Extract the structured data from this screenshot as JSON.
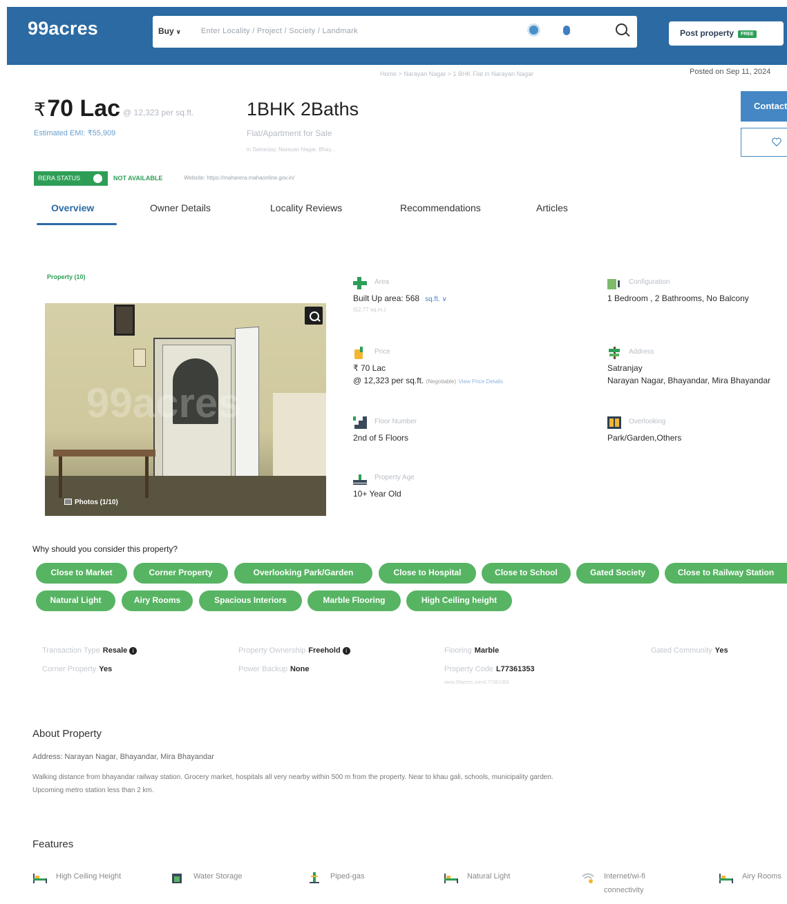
{
  "header": {
    "logo": "99acres",
    "buy_label": "Buy",
    "search_placeholder": "Enter Locality / Project / Society / Landmark",
    "post_property_label": "Post property",
    "free_badge": "FREE"
  },
  "breadcrumb": "Home > Narayan Nagar > 1 BHK Flat in Narayan Nagar",
  "posted": "Posted on Sep 11, 2024",
  "listing": {
    "price": "70 Lac",
    "rupee": "₹",
    "per_sqft": "@ 12,323 per sq.ft.",
    "emi": "Estimated EMI: ₹55,909",
    "config": "1BHK 2Baths",
    "sale_type": "Flat/Apartment for Sale",
    "sale_location": "in Satranjay, Narayan Nagar, Bhay..."
  },
  "actions": {
    "contact": "Contact Owner"
  },
  "rera": {
    "status_label": "RERA STATUS",
    "not_available": "NOT AVAILABLE",
    "website": "Website: https://maharera.mahaonline.gov.in/"
  },
  "tabs": [
    "Overview",
    "Owner Details",
    "Locality Reviews",
    "Recommendations",
    "Articles"
  ],
  "gallery": {
    "property_count": "Property (10)",
    "photos_label": "Photos (1/10)",
    "watermark": "99acres"
  },
  "details": {
    "area": {
      "label": "Area",
      "value": "Built Up area: 568",
      "unit": "sq.ft.",
      "sub": "(52.77 sq.m.)"
    },
    "configuration": {
      "label": "Configuration",
      "value": "1 Bedroom , 2 Bathrooms, No Balcony"
    },
    "price": {
      "label": "Price",
      "value": "₹ 70 Lac",
      "sub": "@ 12,323 per sq.ft.",
      "negotiable": "(Negotiable)",
      "link": "View Price Details"
    },
    "address": {
      "label": "Address",
      "value": "Satranjay",
      "sub": "Narayan Nagar, Bhayandar, Mira Bhayandar"
    },
    "floor": {
      "label": "Floor Number",
      "value": "2nd of 5 Floors"
    },
    "overlooking": {
      "label": "Overlooking",
      "value": "Park/Garden,Others"
    },
    "age": {
      "label": "Property Age",
      "value": "10+ Year Old"
    }
  },
  "why_consider": {
    "title": "Why should you consider this property?",
    "chips": [
      "Close to Market",
      "Corner Property",
      "Overlooking Park/Garden",
      "Close to Hospital",
      "Close to School",
      "Gated Society",
      "Close to Railway Station",
      "Natural Light",
      "Airy Rooms",
      "Spacious Interiors",
      "Marble Flooring",
      "High Ceiling height"
    ]
  },
  "attributes": {
    "transaction": {
      "label": "Transaction Type",
      "value": "Resale"
    },
    "ownership": {
      "label": "Property Ownership",
      "value": "Freehold"
    },
    "flooring": {
      "label": "Flooring",
      "value": "Marble"
    },
    "gated": {
      "label": "Gated Community",
      "value": "Yes"
    },
    "corner": {
      "label": "Corner Property",
      "value": "Yes"
    },
    "power": {
      "label": "Power Backup",
      "value": "None"
    },
    "code": {
      "label": "Property Code",
      "value": "L77361353"
    },
    "url": "www.99acres.com/L77361353"
  },
  "about": {
    "title": "About Property",
    "address": "Address: Narayan Nagar, Bhayandar, Mira Bhayandar",
    "desc_line1": "Walking distance from bhayandar railway station. Grocery market, hospitals all very nearby within 500 m from the property. Near to khau gali, schools, municipality garden.",
    "desc_line2": "Upcoming metro station less than 2 km."
  },
  "features": {
    "title": "Features",
    "items": [
      {
        "label": "High Ceiling Height",
        "icon": "bed-icon"
      },
      {
        "label": "Water Storage",
        "icon": "water-tank-icon"
      },
      {
        "label": "Piped-gas",
        "icon": "gas-icon"
      },
      {
        "label": "Natural Light",
        "icon": "bed-icon"
      },
      {
        "label": "Internet/wi-fi",
        "label2": "connectivity",
        "icon": "wifi-icon"
      },
      {
        "label": "Airy Rooms",
        "icon": "bed-icon"
      }
    ]
  },
  "colors": {
    "brand_blue": "#2b6aa3",
    "green": "#2e9e57",
    "chip_green": "#57b463"
  }
}
